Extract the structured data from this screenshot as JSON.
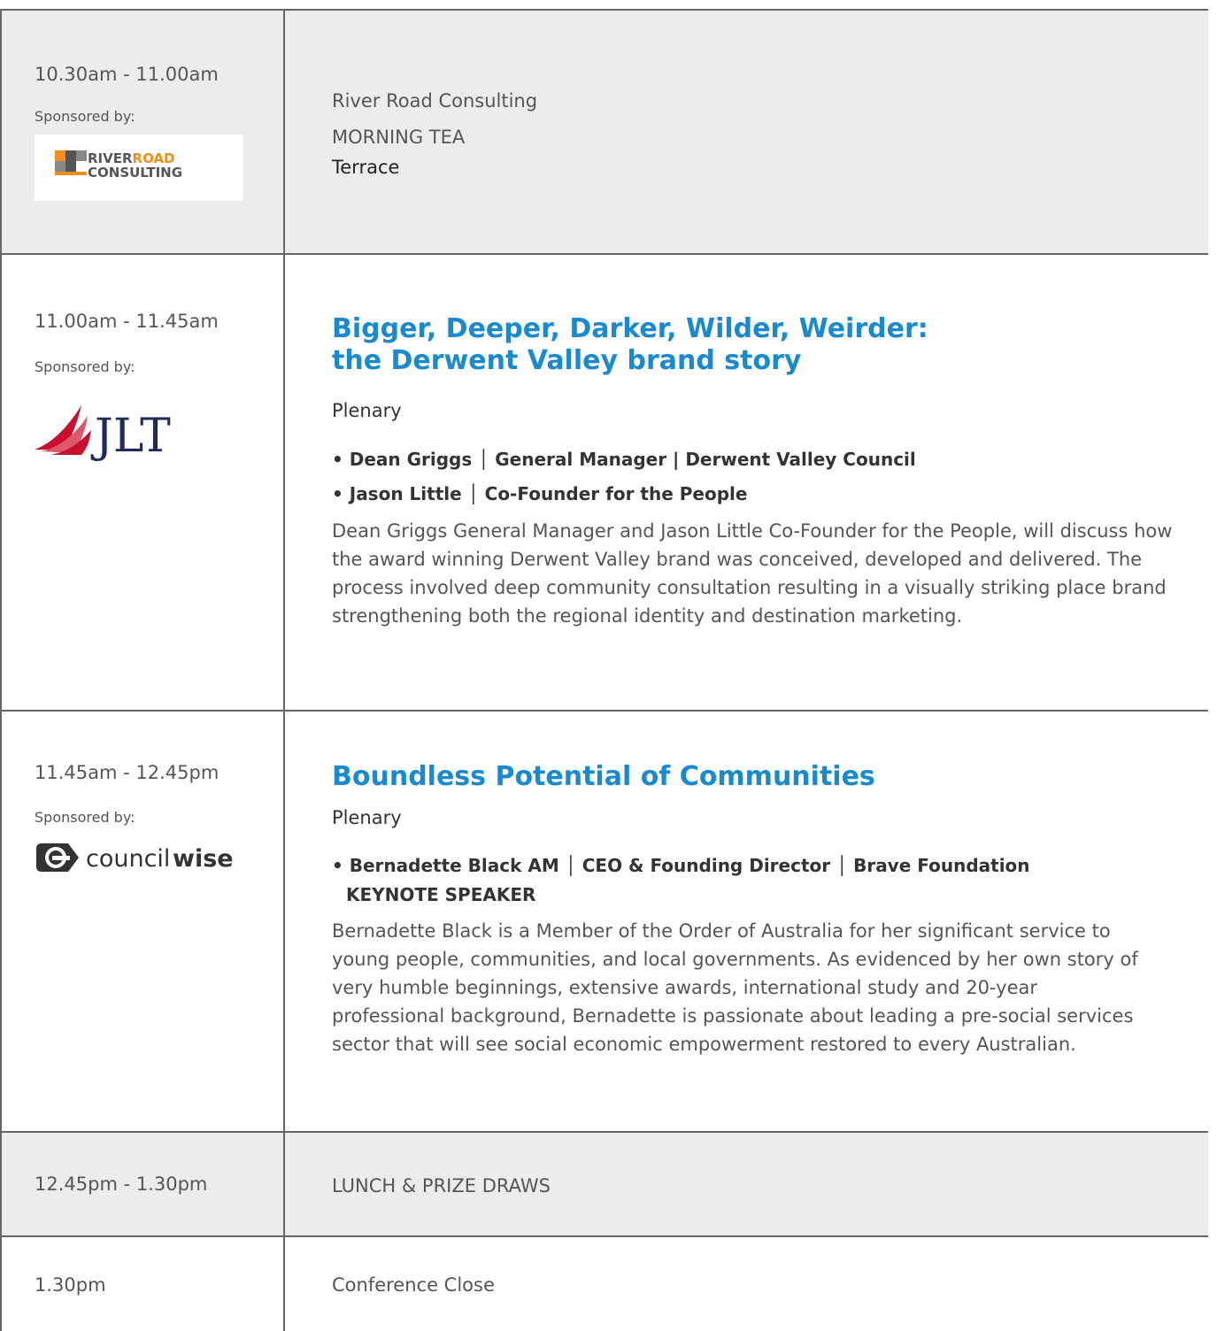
{
  "rows": [
    {
      "time": "10.30am - 11.00am",
      "sponsored_label": "Sponsored by:",
      "sponsor_logo_text": [
        "RIVERROAD",
        "CONSULTING"
      ],
      "line1": "River Road Consulting",
      "line2": "MORNING TEA",
      "line3": "Terrace"
    },
    {
      "time": "11.00am - 11.45am",
      "sponsored_label": "Sponsored by:",
      "sponsor_logo_text": "JLT",
      "title_line1": "Bigger, Deeper, Darker, Wilder, Weirder:",
      "title_line2": "the Derwent Valley brand story",
      "session_type": "Plenary",
      "speakers": [
        "• Dean Griggs │ General Manager | Derwent Valley Council",
        "• Jason Little │ Co-Founder for the People"
      ],
      "description": "Dean Griggs General Manager and Jason Little Co-Founder for the People, will discuss how the award winning Derwent Valley brand was conceived, developed and delivered. The process involved deep community consultation resulting in a visually striking place brand strengthening both the regional identity and destination marketing."
    },
    {
      "time": "11.45am - 12.45pm",
      "sponsored_label": "Sponsored by:",
      "sponsor_logo_text": [
        "council",
        "wise"
      ],
      "title_line1": "Boundless Potential of Communities",
      "session_type": "Plenary",
      "speakers": [
        "• Bernadette Black AM │ CEO & Founding Director │ Brave Foundation",
        "KEYNOTE SPEAKER"
      ],
      "description": "Bernadette Black is a Member of the Order of Australia for her significant service to young people, communities, and local governments. As evidenced by her own story of very humble beginnings, extensive awards, international study and 20-year professional background, Bernadette is passionate about leading a pre-social services sector that will see social economic empowerment restored to every Australian."
    },
    {
      "time": "12.45pm - 1.30pm",
      "event": "LUNCH & PRIZE DRAWS"
    },
    {
      "time": "1.30pm",
      "event": "Conference Close"
    }
  ],
  "colors": {
    "title_blue": "#1a8ad0",
    "row_gray": "#ececec",
    "border": "#666666",
    "jlt_red": "#c8102e",
    "jlt_navy": "#1f2a5a",
    "riverroad_orange": "#f28c1b"
  }
}
